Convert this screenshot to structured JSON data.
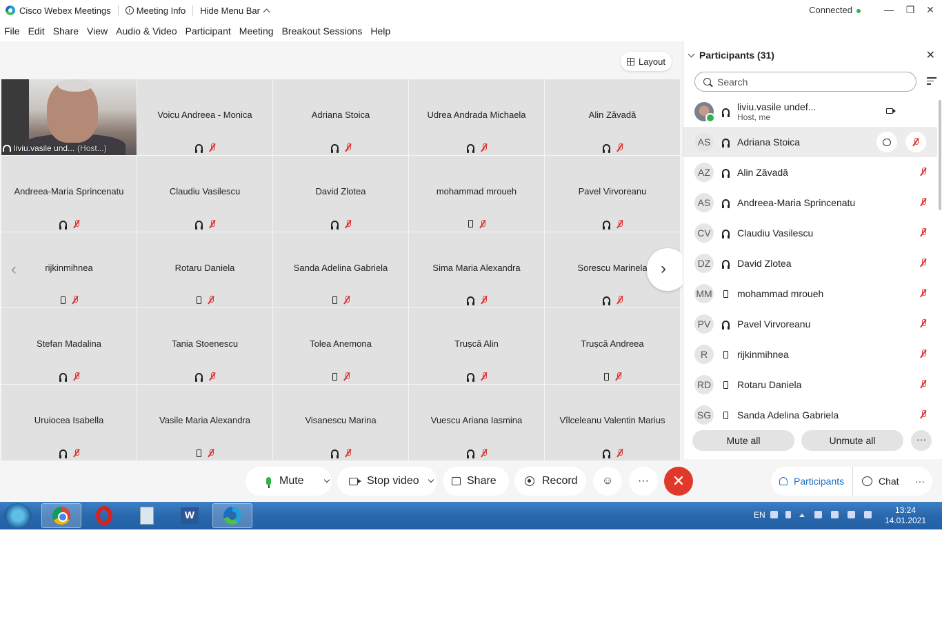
{
  "titlebar": {
    "app_name": "Cisco Webex Meetings",
    "meeting_info": "Meeting Info",
    "hide_menu": "Hide Menu Bar",
    "status": "Connected",
    "minimize": "—",
    "restore": "❐",
    "close": "✕"
  },
  "menu": [
    "File",
    "Edit",
    "Share",
    "View",
    "Audio & Video",
    "Participant",
    "Meeting",
    "Breakout Sessions",
    "Help"
  ],
  "stage": {
    "layout_label": "Layout",
    "self_tile": {
      "name": "liviu.vasile und...",
      "role": "(Host...)"
    },
    "tiles": [
      {
        "name": "Voicu Andreea - Monica",
        "device": "audio"
      },
      {
        "name": "Adriana Stoica",
        "device": "audio"
      },
      {
        "name": "Udrea Andrada Michaela",
        "device": "audio"
      },
      {
        "name": "Alin Zăvadă",
        "device": "audio"
      },
      {
        "name": "Andreea-Maria Sprincenatu",
        "device": "audio"
      },
      {
        "name": "Claudiu Vasilescu",
        "device": "audio"
      },
      {
        "name": "David Zlotea",
        "device": "audio"
      },
      {
        "name": "mohammad mroueh",
        "device": "phone"
      },
      {
        "name": "Pavel Virvoreanu",
        "device": "audio"
      },
      {
        "name": "rijkinmihnea",
        "device": "phone"
      },
      {
        "name": "Rotaru Daniela",
        "device": "phone"
      },
      {
        "name": "Sanda Adelina Gabriela",
        "device": "phone"
      },
      {
        "name": "Sima Maria Alexandra",
        "device": "audio"
      },
      {
        "name": "Sorescu Marinela",
        "device": "audio"
      },
      {
        "name": "Stefan Madalina",
        "device": "audio"
      },
      {
        "name": "Tania Stoenescu",
        "device": "audio"
      },
      {
        "name": "Tolea Anemona",
        "device": "phone"
      },
      {
        "name": "Trușcă Alin",
        "device": "audio"
      },
      {
        "name": "Trușcă Andreea",
        "device": "phone"
      },
      {
        "name": "Uruiocea Isabella",
        "device": "audio"
      },
      {
        "name": "Vasile Maria Alexandra",
        "device": "phone"
      },
      {
        "name": "Visanescu Marina",
        "device": "audio"
      },
      {
        "name": "Vuescu Ariana Iasmina",
        "device": "audio"
      },
      {
        "name": "Vîlceleanu Valentin Marius",
        "device": "audio"
      }
    ],
    "prev_page": "‹",
    "next_page": "›"
  },
  "panel": {
    "title": "Participants (31)",
    "close": "✕",
    "search_placeholder": "Search",
    "host": {
      "name": "liviu.vasile undef...",
      "sub": "Host, me"
    },
    "participants": [
      {
        "initials": "AS",
        "name": "Adriana Stoica",
        "device": "audio",
        "highlighted": true
      },
      {
        "initials": "AZ",
        "name": "Alin Zăvadă",
        "device": "audio"
      },
      {
        "initials": "AS",
        "name": "Andreea-Maria Sprincenatu",
        "device": "audio"
      },
      {
        "initials": "CV",
        "name": "Claudiu Vasilescu",
        "device": "audio"
      },
      {
        "initials": "DZ",
        "name": "David Zlotea",
        "device": "audio"
      },
      {
        "initials": "MM",
        "name": "mohammad mroueh",
        "device": "phone"
      },
      {
        "initials": "PV",
        "name": "Pavel Virvoreanu",
        "device": "audio"
      },
      {
        "initials": "R",
        "name": "rijkinmihnea",
        "device": "phone"
      },
      {
        "initials": "RD",
        "name": "Rotaru Daniela",
        "device": "phone"
      },
      {
        "initials": "SG",
        "name": "Sanda Adelina Gabriela",
        "device": "phone"
      }
    ],
    "mute_all": "Mute all",
    "unmute_all": "Unmute all",
    "more": "···"
  },
  "controls": {
    "mute": "Mute",
    "stop_video": "Stop video",
    "share": "Share",
    "record": "Record",
    "reactions": "☺",
    "more": "···",
    "end": "✕",
    "participants": "Participants",
    "chat": "Chat",
    "more_right": "···"
  },
  "taskbar": {
    "language": "EN",
    "time": "13:24",
    "date": "14.01.2021"
  },
  "colors": {
    "accent": "#1a6ec1",
    "end_call": "#e0392b",
    "muted": "#d33333",
    "connected": "#2fb34a"
  }
}
